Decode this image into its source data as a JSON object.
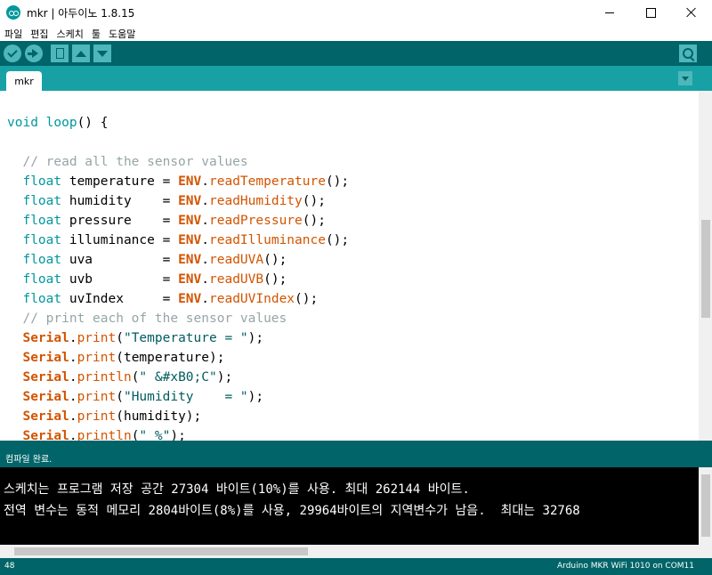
{
  "window": {
    "title": "mkr | 아두이노 1.8.15"
  },
  "menu": {
    "items": [
      "파일",
      "편집",
      "스케치",
      "툴",
      "도움말"
    ]
  },
  "tabs": [
    "mkr"
  ],
  "code_lines": [
    [
      {
        "t": "void loop() {",
        "c": "kw-part"
      }
    ],
    [],
    [
      {
        "t": "  // read all the sensor values",
        "c": "cm"
      }
    ],
    [
      {
        "t": "  float",
        "c": "kw"
      },
      {
        "t": " temperature = ",
        "c": ""
      },
      {
        "t": "ENV",
        "c": "cls"
      },
      {
        "t": ".",
        "c": ""
      },
      {
        "t": "readTemperature",
        "c": "fn"
      },
      {
        "t": "();",
        "c": ""
      }
    ],
    [
      {
        "t": "  float",
        "c": "kw"
      },
      {
        "t": " humidity    = ",
        "c": ""
      },
      {
        "t": "ENV",
        "c": "cls"
      },
      {
        "t": ".",
        "c": ""
      },
      {
        "t": "readHumidity",
        "c": "fn"
      },
      {
        "t": "();",
        "c": ""
      }
    ],
    [
      {
        "t": "  float",
        "c": "kw"
      },
      {
        "t": " pressure    = ",
        "c": ""
      },
      {
        "t": "ENV",
        "c": "cls"
      },
      {
        "t": ".",
        "c": ""
      },
      {
        "t": "readPressure",
        "c": "fn"
      },
      {
        "t": "();",
        "c": ""
      }
    ],
    [
      {
        "t": "  float",
        "c": "kw"
      },
      {
        "t": " illuminance = ",
        "c": ""
      },
      {
        "t": "ENV",
        "c": "cls"
      },
      {
        "t": ".",
        "c": ""
      },
      {
        "t": "readIlluminance",
        "c": "fn"
      },
      {
        "t": "();",
        "c": ""
      }
    ],
    [
      {
        "t": "  float",
        "c": "kw"
      },
      {
        "t": " uva         = ",
        "c": ""
      },
      {
        "t": "ENV",
        "c": "cls"
      },
      {
        "t": ".",
        "c": ""
      },
      {
        "t": "readUVA",
        "c": "fn"
      },
      {
        "t": "();",
        "c": ""
      }
    ],
    [
      {
        "t": "  float",
        "c": "kw"
      },
      {
        "t": " uvb         = ",
        "c": ""
      },
      {
        "t": "ENV",
        "c": "cls"
      },
      {
        "t": ".",
        "c": ""
      },
      {
        "t": "readUVB",
        "c": "fn"
      },
      {
        "t": "();",
        "c": ""
      }
    ],
    [
      {
        "t": "  float",
        "c": "kw"
      },
      {
        "t": " uvIndex     = ",
        "c": ""
      },
      {
        "t": "ENV",
        "c": "cls"
      },
      {
        "t": ".",
        "c": ""
      },
      {
        "t": "readUVIndex",
        "c": "fn"
      },
      {
        "t": "();",
        "c": ""
      }
    ],
    [
      {
        "t": "  // print each of the sensor values",
        "c": "cm"
      }
    ],
    [
      {
        "t": "  Serial",
        "c": "cls"
      },
      {
        "t": ".",
        "c": ""
      },
      {
        "t": "print",
        "c": "fn"
      },
      {
        "t": "(",
        "c": ""
      },
      {
        "t": "\"Temperature = \"",
        "c": "str"
      },
      {
        "t": ");",
        "c": ""
      }
    ],
    [
      {
        "t": "  Serial",
        "c": "cls"
      },
      {
        "t": ".",
        "c": ""
      },
      {
        "t": "print",
        "c": "fn"
      },
      {
        "t": "(temperature);",
        "c": ""
      }
    ],
    [
      {
        "t": "  Serial",
        "c": "cls"
      },
      {
        "t": ".",
        "c": ""
      },
      {
        "t": "println",
        "c": "fn"
      },
      {
        "t": "(",
        "c": ""
      },
      {
        "t": "\" &#xB0;C\"",
        "c": "str"
      },
      {
        "t": ");",
        "c": ""
      }
    ],
    [
      {
        "t": "  Serial",
        "c": "cls"
      },
      {
        "t": ".",
        "c": ""
      },
      {
        "t": "print",
        "c": "fn"
      },
      {
        "t": "(",
        "c": ""
      },
      {
        "t": "\"Humidity    = \"",
        "c": "str"
      },
      {
        "t": ");",
        "c": ""
      }
    ],
    [
      {
        "t": "  Serial",
        "c": "cls"
      },
      {
        "t": ".",
        "c": ""
      },
      {
        "t": "print",
        "c": "fn"
      },
      {
        "t": "(humidity);",
        "c": ""
      }
    ],
    [
      {
        "t": "  Serial",
        "c": "cls"
      },
      {
        "t": ".",
        "c": ""
      },
      {
        "t": "println",
        "c": "fn"
      },
      {
        "t": "(",
        "c": ""
      },
      {
        "t": "\" %\"",
        "c": "str"
      },
      {
        "t": ");",
        "c": ""
      }
    ]
  ],
  "console": {
    "status": "컴파일 완료.",
    "lines": [
      "스케치는 프로그램 저장 공간 27304 바이트(10%)를 사용. 최대 262144 바이트.",
      "전역 변수는 동적 메모리 2804바이트(8%)를 사용, 29964바이트의 지역변수가 남음.  최대는 32768"
    ]
  },
  "statusbar": {
    "line": "48",
    "board": "Arduino MKR WiFi 1010 on COM11"
  },
  "colors": {
    "toolbar": "#006468",
    "tabbar": "#17a1a5",
    "keyword": "#00979c",
    "class": "#d35400",
    "comment": "#95a5a6"
  }
}
